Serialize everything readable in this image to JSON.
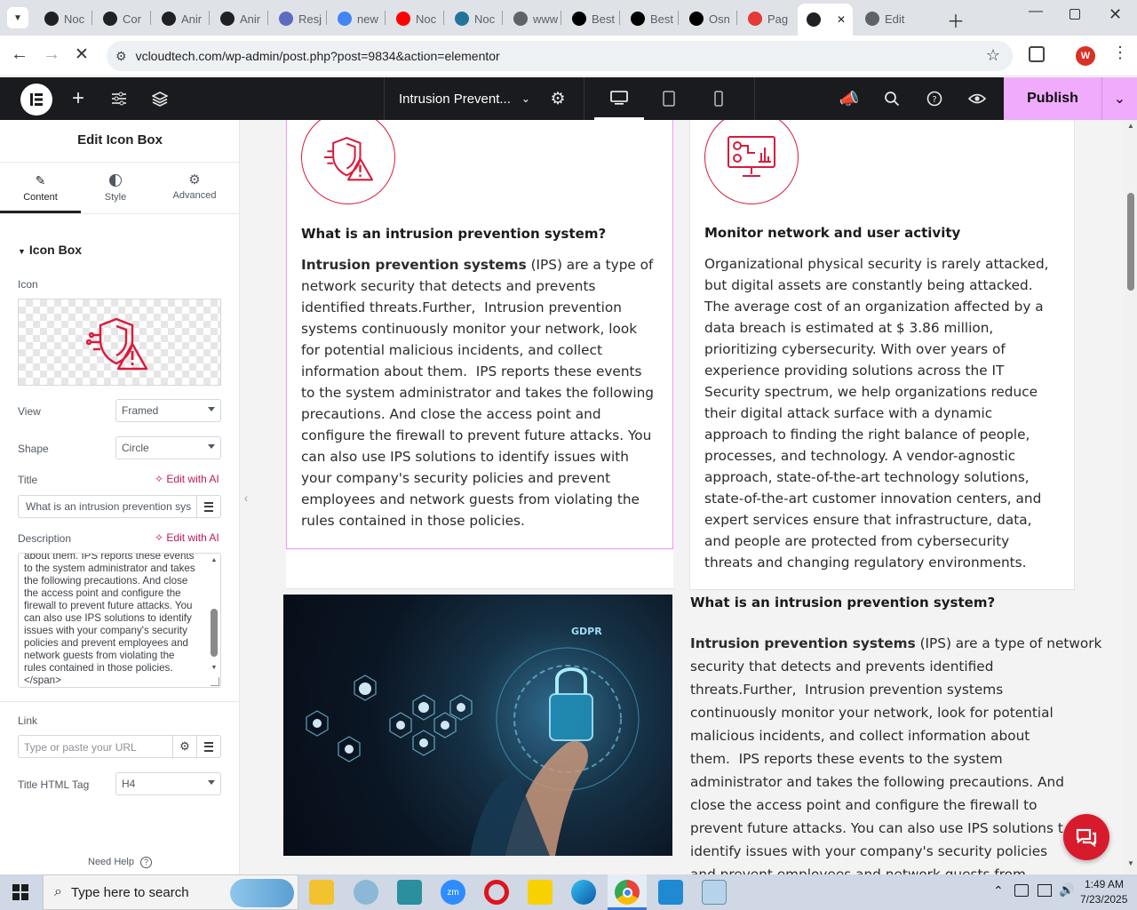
{
  "browser": {
    "tabs": [
      {
        "label": "Noc",
        "color": "#202124"
      },
      {
        "label": "Cor",
        "color": "#202124"
      },
      {
        "label": "Anir",
        "color": "#202124"
      },
      {
        "label": "Anir",
        "color": "#202124"
      },
      {
        "label": "Resj",
        "color": "#5c6bc0"
      },
      {
        "label": "new",
        "color": "#4285f4"
      },
      {
        "label": "Noc",
        "color": "#ff0000"
      },
      {
        "label": "Noc",
        "color": "#21759b"
      },
      {
        "label": "www",
        "color": "#5f6368"
      },
      {
        "label": "Best",
        "color": "#000000"
      },
      {
        "label": "Best",
        "color": "#000000"
      },
      {
        "label": "Osn",
        "color": "#000000"
      },
      {
        "label": "Pag",
        "color": "#e53935"
      },
      {
        "label": "",
        "color": "#202124"
      },
      {
        "label": "Edit",
        "color": "#5f6368"
      }
    ],
    "url": "vcloudtech.com/wp-admin/post.php?post=9834&action=elementor",
    "profile_initial": "W"
  },
  "elementor_bar": {
    "page_title": "Intrusion Prevent...",
    "publish_label": "Publish"
  },
  "panel": {
    "heading": "Edit Icon Box",
    "tabs": [
      {
        "label": "Content"
      },
      {
        "label": "Style"
      },
      {
        "label": "Advanced"
      }
    ],
    "section_title": "Icon Box",
    "icon_label": "Icon",
    "view_label": "View",
    "view_value": "Framed",
    "shape_label": "Shape",
    "shape_value": "Circle",
    "title_label": "Title",
    "edit_ai": "Edit with AI",
    "title_value": "What is an intrusion prevention sys",
    "description_label": "Description",
    "description_lines": [
      "about them.  IPS reports these events",
      "to the system administrator and takes",
      "the following precautions. And close",
      "the access point and configure the",
      "firewall to prevent future attacks. You",
      "can also use IPS solutions to identify",
      "issues with your company's security",
      "policies and prevent employees and",
      "network guests from violating the",
      "rules contained in those policies.",
      "</span>"
    ],
    "link_label": "Link",
    "link_placeholder": "Type or paste your URL",
    "html_tag_label": "Title HTML Tag",
    "html_tag_value": "H4",
    "need_help": "Need Help"
  },
  "canvas": {
    "left_box": {
      "title": "What is an intrusion prevention system?",
      "body_strong": "Intrusion prevention systems",
      "body_lines": [
        " (IPS) are a type of",
        "network security that detects and prevents",
        "identified threats.Further,  Intrusion prevention",
        "systems continuously monitor your network, look",
        "for potential malicious incidents, and collect",
        "information about them.  IPS reports these events",
        "to the system administrator and takes the following",
        "precautions. And close the access point and",
        "configure the firewall to prevent future attacks. You",
        "can also use IPS solutions to identify issues with",
        "your company's security policies and prevent",
        "employees and network guests from violating the",
        "rules contained in those policies."
      ]
    },
    "right_box": {
      "title": "Monitor network and user activity",
      "body_lines": [
        "Organizational physical security is rarely attacked,",
        "but digital assets are constantly being attacked.",
        "The average cost of an organization affected by a",
        "data breach is estimated at $ 3.86 million,",
        "prioritizing cybersecurity. With over years of",
        "experience providing solutions across the IT",
        "Security spectrum, we help organizations reduce",
        "their digital attack surface with a dynamic",
        "approach to finding the right balance of people,",
        "processes, and technology. A vendor-agnostic",
        "approach, state-of-the-art technology solutions,",
        "state-of-the-art customer innovation centers, and",
        "expert services ensure that infrastructure, data,",
        "and people are protected from cybersecurity",
        "threats and changing regulatory environments."
      ]
    },
    "lower_text": {
      "title": "What is an intrusion prevention system?",
      "body_strong": "Intrusion prevention systems",
      "body_lines": [
        " (IPS) are a type of network",
        "security that detects and prevents identified",
        "threats.Further,  Intrusion prevention systems",
        "continuously monitor your network, look for potential",
        "malicious incidents, and collect information about",
        "them.  IPS reports these events to the system",
        "administrator and takes the following precautions. And",
        "close the access point and configure the firewall to",
        "prevent future attacks. You can also use IPS solutions t",
        "identify issues with your company's security policies",
        "and prevent employees and network guests from"
      ]
    },
    "image_gdpr_text": "GDPR"
  },
  "taskbar": {
    "search_placeholder": "Type here to search",
    "time": "1:49 AM",
    "date": "7/23/2025"
  },
  "colors": {
    "accent": "#e11d48",
    "publish": "#f0abfc",
    "elementor_dark": "#1a1b1e"
  }
}
